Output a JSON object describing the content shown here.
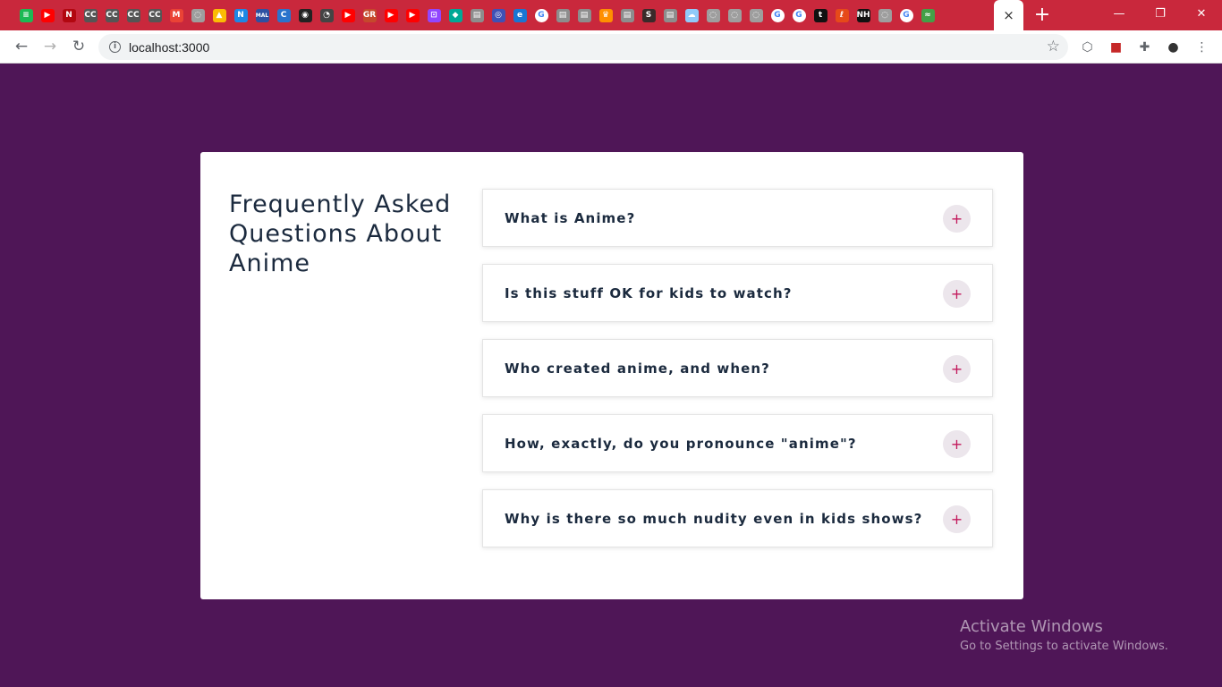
{
  "browser": {
    "bookmarks": [
      {
        "icon": "spotify-icon",
        "color": "#1db954",
        "glyph": "≡"
      },
      {
        "icon": "youtube-icon",
        "color": "#ff0000",
        "glyph": "▶"
      },
      {
        "icon": "netflix-icon",
        "color": "#b20710",
        "glyph": "N"
      },
      {
        "icon": "cc-icon",
        "color": "#555555",
        "glyph": "CC"
      },
      {
        "icon": "cc-icon",
        "color": "#555555",
        "glyph": "CC"
      },
      {
        "icon": "cc-icon",
        "color": "#555555",
        "glyph": "CC"
      },
      {
        "icon": "cc-icon",
        "color": "#555555",
        "glyph": "CC"
      },
      {
        "icon": "gmail-icon",
        "color": "#ea4335",
        "glyph": "M"
      },
      {
        "icon": "generic-site-icon",
        "color": "#9e9e9e",
        "glyph": "◌"
      },
      {
        "icon": "google-drive-icon",
        "color": "#fbbc04",
        "glyph": "▲"
      },
      {
        "icon": "notion-icon",
        "color": "#1e88e5",
        "glyph": "N"
      },
      {
        "icon": "myanimelist-icon",
        "color": "#2e51a2",
        "glyph": "MAL"
      },
      {
        "icon": "coursera-icon",
        "color": "#2a73cc",
        "glyph": "C"
      },
      {
        "icon": "github-icon",
        "color": "#222222",
        "glyph": "◉"
      },
      {
        "icon": "speedometer-icon",
        "color": "#444444",
        "glyph": "◔"
      },
      {
        "icon": "youtube-icon",
        "color": "#ff0000",
        "glyph": "▶"
      },
      {
        "icon": "goodreads-icon",
        "color": "#c5492c",
        "glyph": "GR"
      },
      {
        "icon": "youtube-icon",
        "color": "#ff0000",
        "glyph": "▶"
      },
      {
        "icon": "youtube-icon",
        "color": "#ff0000",
        "glyph": "▶"
      },
      {
        "icon": "twitch-icon",
        "color": "#9146ff",
        "glyph": "⊡"
      },
      {
        "icon": "diamond-icon",
        "color": "#00a896",
        "glyph": "◆"
      },
      {
        "icon": "manga-icon",
        "color": "#8d8d8d",
        "glyph": "▤"
      },
      {
        "icon": "wifi-icon",
        "color": "#3f51b5",
        "glyph": "◎"
      },
      {
        "icon": "edge-doc-icon",
        "color": "#1976d2",
        "glyph": "e"
      },
      {
        "icon": "google-icon",
        "color": "#ffffff",
        "glyph": "G"
      },
      {
        "icon": "manga-icon",
        "color": "#8d8d8d",
        "glyph": "▤"
      },
      {
        "icon": "manga-icon",
        "color": "#8d8d8d",
        "glyph": "▤"
      },
      {
        "icon": "crown-icon",
        "color": "#ff8f00",
        "glyph": "♛"
      },
      {
        "icon": "manga-icon",
        "color": "#8d8d8d",
        "glyph": "▤"
      },
      {
        "icon": "comic-icon",
        "color": "#3a2a2a",
        "glyph": "S"
      },
      {
        "icon": "manga-icon",
        "color": "#8d8d8d",
        "glyph": "▤"
      },
      {
        "icon": "cloud-icon",
        "color": "#90caf9",
        "glyph": "☁"
      },
      {
        "icon": "generic-site-icon",
        "color": "#9e9e9e",
        "glyph": "◌"
      },
      {
        "icon": "generic-site-icon",
        "color": "#9e9e9e",
        "glyph": "◌"
      },
      {
        "icon": "generic-site-icon",
        "color": "#9e9e9e",
        "glyph": "◌"
      },
      {
        "icon": "google-icon",
        "color": "#ffffff",
        "glyph": "G"
      },
      {
        "icon": "google-icon",
        "color": "#ffffff",
        "glyph": "G"
      },
      {
        "icon": "tumblr-icon",
        "color": "#111111",
        "glyph": "t"
      },
      {
        "icon": "ladder-icon",
        "color": "#e64a19",
        "glyph": "ℓ"
      },
      {
        "icon": "nh-icon",
        "color": "#111111",
        "glyph": "NH"
      },
      {
        "icon": "generic-site-icon",
        "color": "#9e9e9e",
        "glyph": "◌"
      },
      {
        "icon": "google-icon",
        "color": "#ffffff",
        "glyph": "G"
      },
      {
        "icon": "plant-icon",
        "color": "#43a047",
        "glyph": "≈"
      }
    ],
    "active_tab_close": "×",
    "new_tab": "+",
    "window_controls": {
      "minimize": "—",
      "restore": "❐",
      "close": "✕"
    },
    "nav": {
      "back": "←",
      "forward": "→",
      "reload": "↻"
    },
    "url": "localhost:3000",
    "extensions": [
      {
        "icon": "hexagon-extension-icon",
        "glyph": "⬡"
      },
      {
        "icon": "red-extension-icon",
        "glyph": "■"
      },
      {
        "icon": "puzzle-extensions-icon",
        "glyph": "✚"
      },
      {
        "icon": "profile-avatar-icon",
        "glyph": "●"
      },
      {
        "icon": "kebab-menu-icon",
        "glyph": "⋮"
      }
    ]
  },
  "page": {
    "background": "#4f1657",
    "title": "Frequently Asked Questions About Anime",
    "faqs": [
      {
        "question": "What is Anime?",
        "toggle": "+"
      },
      {
        "question": "Is this stuff OK for kids to watch?",
        "toggle": "+"
      },
      {
        "question": "Who created anime, and when?",
        "toggle": "+"
      },
      {
        "question": "How, exactly, do you pronounce \"anime\"?",
        "toggle": "+"
      },
      {
        "question": "Why is there so much nudity even in kids shows?",
        "toggle": "+"
      }
    ],
    "accent_color": "#c2185b"
  },
  "watermark": {
    "title": "Activate Windows",
    "subtitle": "Go to Settings to activate Windows."
  }
}
